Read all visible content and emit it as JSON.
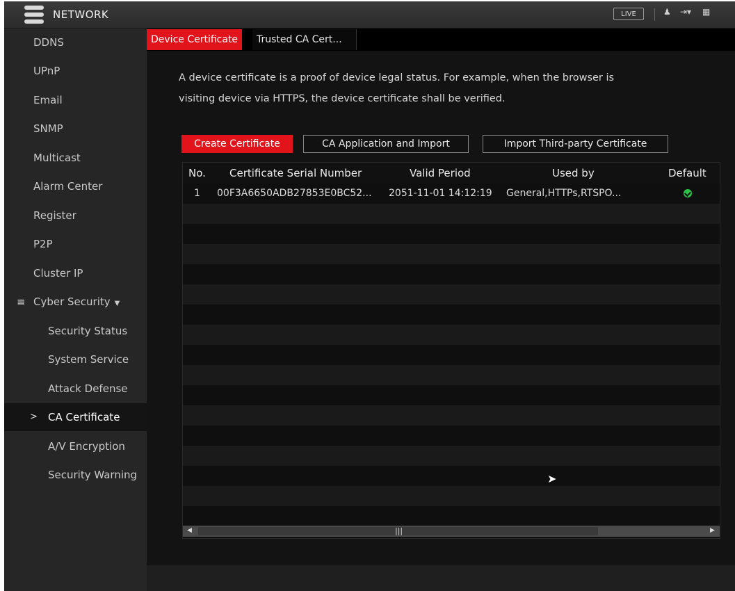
{
  "topbar": {
    "title": "NETWORK",
    "live_label": "LIVE"
  },
  "sidebar": {
    "items": [
      {
        "label": "DDNS"
      },
      {
        "label": "UPnP"
      },
      {
        "label": "Email"
      },
      {
        "label": "SNMP"
      },
      {
        "label": "Multicast"
      },
      {
        "label": "Alarm Center"
      },
      {
        "label": "Register"
      },
      {
        "label": "P2P"
      },
      {
        "label": "Cluster IP"
      },
      {
        "label": "Cyber Security"
      }
    ],
    "subitems": [
      {
        "label": "Security Status"
      },
      {
        "label": "System Service"
      },
      {
        "label": "Attack Defense"
      },
      {
        "label": "CA Certificate",
        "active": true
      },
      {
        "label": "A/V Encryption"
      },
      {
        "label": "Security Warning"
      }
    ]
  },
  "tabs": [
    {
      "label": "Device Certificate",
      "active": true
    },
    {
      "label": "Trusted CA Cert..."
    }
  ],
  "description": {
    "line1": "A device certificate is a proof of device legal status. For example, when the browser is",
    "line2": "visiting device via HTTPS, the device certificate shall be verified."
  },
  "actions": {
    "create": "Create Certificate",
    "ca_apply": "CA Application and Import",
    "import_third": "Import Third-party Certificate"
  },
  "table": {
    "columns": [
      "No.",
      "Certificate Serial Number",
      "Valid Period",
      "Used by",
      "Default"
    ],
    "rows": [
      {
        "no": "1",
        "serial": "00F3A6650ADB27853E0BC52...",
        "valid": "2051-11-01 14:12:19",
        "used_by": "General,HTTPs,RTSPO...",
        "default": true
      }
    ]
  },
  "colors": {
    "accent": "#e0141a",
    "default_check": "#2bc24a"
  }
}
